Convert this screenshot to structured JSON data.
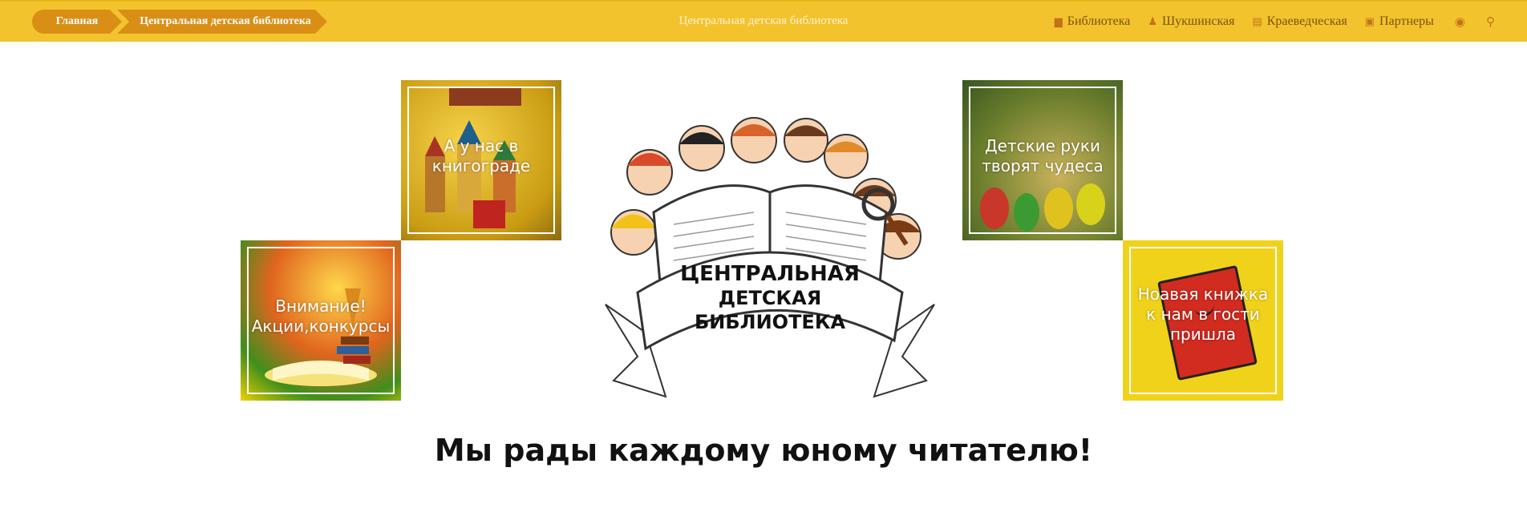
{
  "breadcrumb": {
    "home": "Главная",
    "current": "Центральная детская библиотека"
  },
  "header": {
    "title": "Центральная детская библиотека"
  },
  "nav": {
    "items": [
      {
        "label": "Библиотека",
        "icon": "book-icon"
      },
      {
        "label": "Шукшинская",
        "icon": "person-icon"
      },
      {
        "label": "Краеведческая",
        "icon": "document-icon"
      },
      {
        "label": "Партнеры",
        "icon": "contact-icon"
      }
    ],
    "user_icon": "user-circle-icon",
    "search_icon": "search-icon"
  },
  "tiles": [
    {
      "label": "А у нас в книгограде"
    },
    {
      "label": "Внимание! Акции,конкурсы"
    },
    {
      "label": "Детские руки творят чудеса"
    },
    {
      "label": "Ноавая книжка к нам в гости пришла"
    }
  ],
  "logo": {
    "lines": [
      "ЦЕНТРАЛЬНАЯ",
      "ДЕТСКАЯ",
      "БИБЛИОТЕКА"
    ]
  },
  "slogan": "Мы рады каждому юному читателю!",
  "colors": {
    "bar": "#f3c32e",
    "crumb": "#d98f16",
    "nav_text": "#7a5210"
  }
}
